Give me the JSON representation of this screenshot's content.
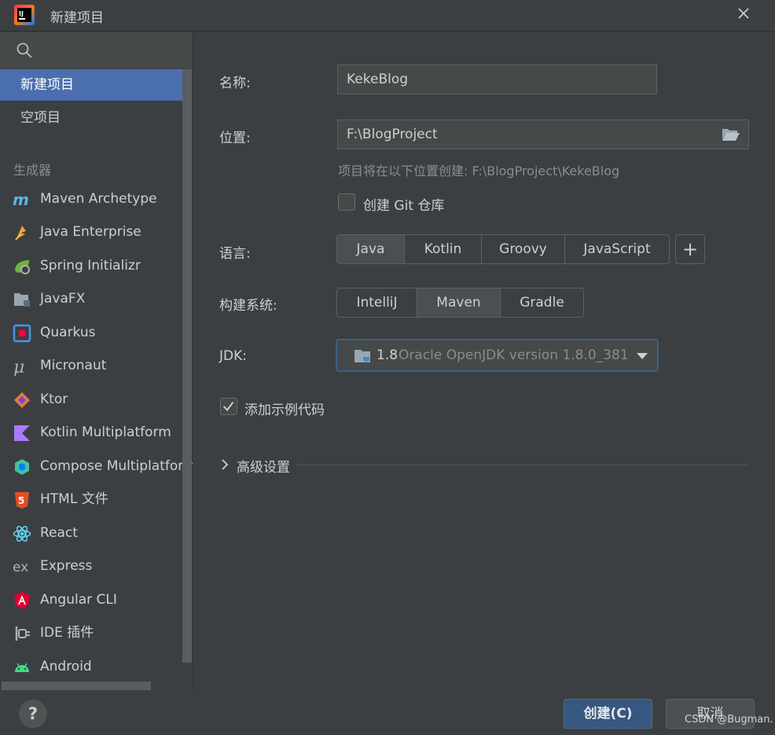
{
  "window": {
    "title": "新建项目"
  },
  "sidebar": {
    "top_items": [
      {
        "label": "新建项目",
        "selected": true
      },
      {
        "label": "空项目",
        "selected": false
      }
    ],
    "section_label": "生成器",
    "generators": [
      {
        "label": "Maven Archetype",
        "icon": "maven-icon",
        "color": "#5db2e5"
      },
      {
        "label": "Java Enterprise",
        "icon": "java-enterprise-icon",
        "color": "#f0a030"
      },
      {
        "label": "Spring Initializr",
        "icon": "spring-icon",
        "color": "#6db33f"
      },
      {
        "label": "JavaFX",
        "icon": "javafx-icon",
        "color": "#9aa7b0"
      },
      {
        "label": "Quarkus",
        "icon": "quarkus-icon",
        "color": "#4695eb"
      },
      {
        "label": "Micronaut",
        "icon": "micronaut-icon",
        "color": "#afb1b3"
      },
      {
        "label": "Ktor",
        "icon": "ktor-icon",
        "color": "#e8793c"
      },
      {
        "label": "Kotlin Multiplatform",
        "icon": "kotlin-icon",
        "color": "#a97bff"
      },
      {
        "label": "Compose Multiplatform",
        "icon": "compose-icon",
        "color": "#42c2a4"
      },
      {
        "label": "HTML 文件",
        "icon": "html5-icon",
        "color": "#e44d26"
      },
      {
        "label": "React",
        "icon": "react-icon",
        "color": "#61dafb"
      },
      {
        "label": "Express",
        "icon": "express-icon",
        "color": "#afb1b3"
      },
      {
        "label": "Angular CLI",
        "icon": "angular-icon",
        "color": "#dd0031"
      },
      {
        "label": "IDE 插件",
        "icon": "plugin-icon",
        "color": "#afb1b3"
      },
      {
        "label": "Android",
        "icon": "android-icon",
        "color": "#3ddc84"
      }
    ]
  },
  "form": {
    "name_label": "名称:",
    "name_value": "KekeBlog",
    "location_label": "位置:",
    "location_value": "F:\\BlogProject",
    "location_hint": "项目将在以下位置创建: F:\\BlogProject\\KekeBlog",
    "git_checkbox_label": "创建 Git 仓库",
    "git_checked": false,
    "language_label": "语言:",
    "languages": [
      "Java",
      "Kotlin",
      "Groovy",
      "JavaScript"
    ],
    "selected_language": "Java",
    "add_language_label": "+",
    "build_label": "构建系统:",
    "build_systems": [
      "IntelliJ",
      "Maven",
      "Gradle"
    ],
    "selected_build": "Maven",
    "jdk_label": "JDK:",
    "jdk_version": "1.8",
    "jdk_description": "Oracle OpenJDK version 1.8.0_381",
    "sample_code_label": "添加示例代码",
    "sample_code_checked": true,
    "advanced_label": "高级设置"
  },
  "footer": {
    "help_label": "?",
    "create_label": "创建(C)",
    "cancel_label": "取消",
    "watermark": "CSDN @Bugman."
  },
  "colors": {
    "accent_selected": "#4b6eaf",
    "primary_button": "#365880",
    "background": "#3c3f41"
  }
}
